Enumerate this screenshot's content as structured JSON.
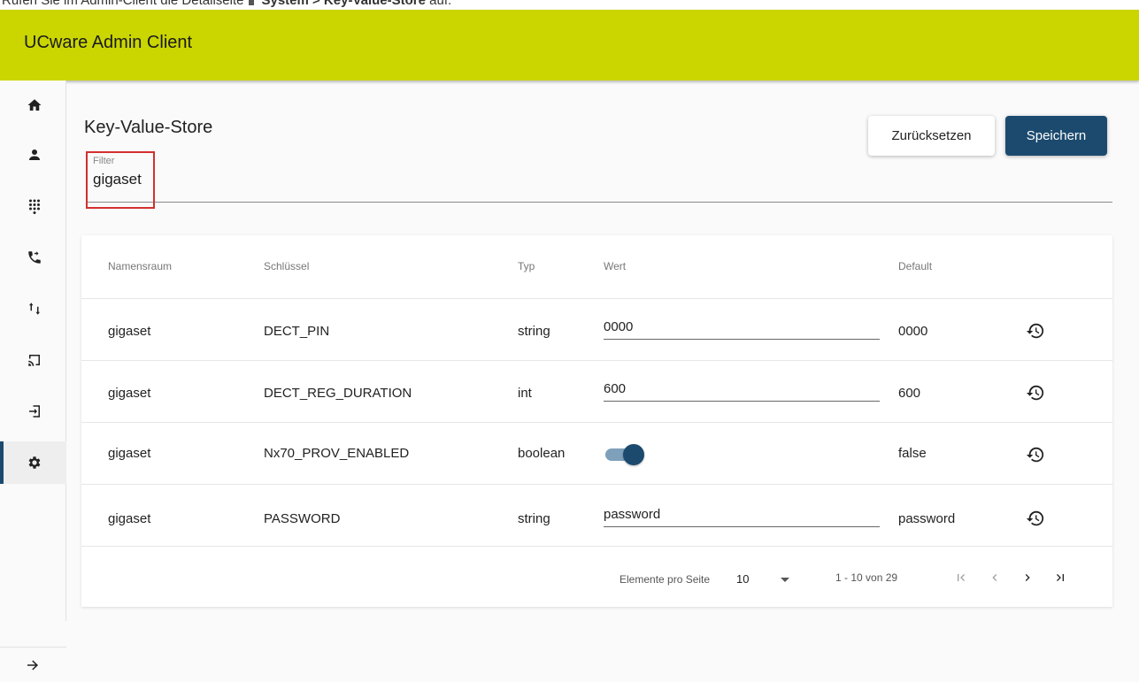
{
  "instruction": {
    "prefix": "Rufen Sie im Admin-Client die Detailseite",
    "path": "System > Key-Value-Store",
    "suffix": "auf."
  },
  "header": {
    "title": "UCware Admin Client"
  },
  "sidebar": {
    "items": [
      {
        "icon": "home-icon",
        "active": false
      },
      {
        "icon": "user-icon",
        "active": false
      },
      {
        "icon": "dialpad-icon",
        "active": false
      },
      {
        "icon": "phone-forward-icon",
        "active": false
      },
      {
        "icon": "swap-vertical-icon",
        "active": false
      },
      {
        "icon": "cast-icon",
        "active": false
      },
      {
        "icon": "login-icon",
        "active": false
      },
      {
        "icon": "gear-icon",
        "active": true
      }
    ],
    "collapse_icon": "arrow-right-icon"
  },
  "page": {
    "title": "Key-Value-Store",
    "reset_label": "Zurücksetzen",
    "save_label": "Speichern",
    "filter": {
      "label": "Filter",
      "value": "gigaset"
    }
  },
  "table": {
    "columns": [
      "Namensraum",
      "Schlüssel",
      "Typ",
      "Wert",
      "Default"
    ],
    "rows": [
      {
        "namespace": "gigaset",
        "key": "DECT_PIN",
        "type": "string",
        "value": "0000",
        "default": "0000"
      },
      {
        "namespace": "gigaset",
        "key": "DECT_REG_DURATION",
        "type": "int",
        "value": "600",
        "default": "600"
      },
      {
        "namespace": "gigaset",
        "key": "Nx70_PROV_ENABLED",
        "type": "boolean",
        "value": "",
        "toggle_on": true,
        "default": "false"
      },
      {
        "namespace": "gigaset",
        "key": "PASSWORD",
        "type": "string",
        "value": "password",
        "default": "password"
      }
    ]
  },
  "paginator": {
    "items_per_page_label": "Elemente pro Seite",
    "page_size": "10",
    "range": "1 - 10 von 29"
  },
  "colors": {
    "header_bg": "#cbd600",
    "primary": "#1b4a6e",
    "highlight": "#d32f2f"
  }
}
